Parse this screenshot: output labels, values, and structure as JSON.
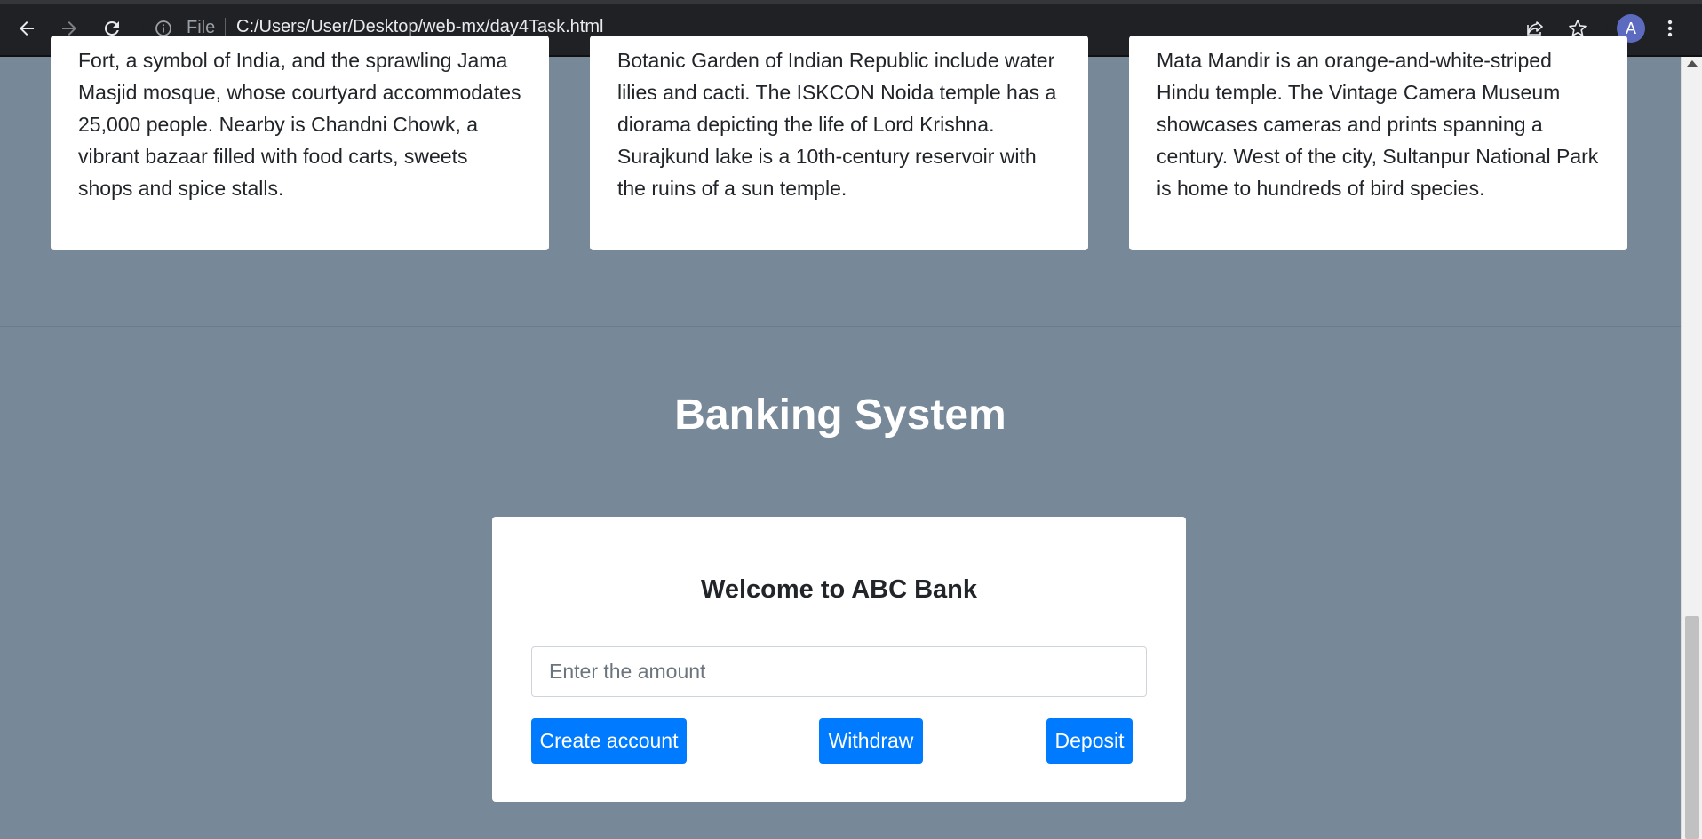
{
  "browser": {
    "scheme_label": "File",
    "url": "C:/Users/User/Desktop/web-mx/day4Task.html",
    "avatar_letter": "A",
    "icons": [
      "back-arrow-icon",
      "forward-arrow-icon",
      "reload-icon",
      "info-icon",
      "share-icon",
      "star-icon",
      "kebab-menu-icon"
    ]
  },
  "cards": [
    {
      "text": "Fort, a symbol of India, and the sprawling Jama Masjid mosque, whose courtyard accommodates 25,000 people. Nearby is Chandni Chowk, a vibrant bazaar filled with food carts, sweets shops and spice stalls."
    },
    {
      "text": "Botanic Garden of Indian Republic include water lilies and cacti. The ISKCON Noida temple has a diorama depicting the life of Lord Krishna. Surajkund lake is a 10th-century reservoir with the ruins of a sun temple."
    },
    {
      "text": "Mata Mandir is an orange-and-white-striped Hindu temple. The Vintage Camera Museum showcases cameras and prints spanning a century. West of the city, Sultanpur National Park is home to hundreds of bird species."
    }
  ],
  "banking": {
    "section_title": "Banking System",
    "card_title": "Welcome to ABC Bank",
    "amount_placeholder": "Enter the amount",
    "buttons": {
      "create": "Create account",
      "withdraw": "Withdraw",
      "deposit": "Deposit"
    }
  },
  "colors": {
    "page_background": "#778899",
    "button_primary": "#007bff",
    "chrome_background": "#202124"
  }
}
